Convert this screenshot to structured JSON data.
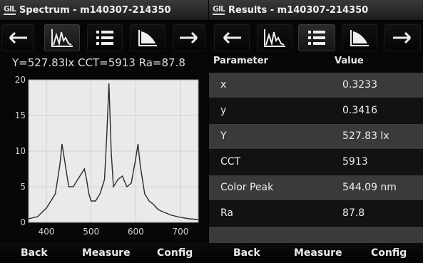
{
  "left": {
    "logo": "GIL",
    "title": "Spectrum - m140307-214350",
    "toolbar": [
      "back-arrow-icon",
      "spectrum-icon",
      "list-icon",
      "gamut-icon",
      "forward-arrow-icon"
    ],
    "readout": "Y=527.83lx   CCT=5913   Ra=87.8",
    "bottom": {
      "back": "Back",
      "measure": "Measure",
      "config": "Config"
    }
  },
  "right": {
    "logo": "GIL",
    "title": "Results - m140307-214350",
    "toolbar": [
      "back-arrow-icon",
      "spectrum-icon",
      "list-icon",
      "gamut-icon",
      "forward-arrow-icon"
    ],
    "headers": {
      "parameter": "Parameter",
      "value": "Value"
    },
    "rows": [
      {
        "param": "x",
        "value": "0.3233"
      },
      {
        "param": "y",
        "value": "0.3416"
      },
      {
        "param": "Y",
        "value": "527.83 lx"
      },
      {
        "param": "CCT",
        "value": "5913"
      },
      {
        "param": "Color Peak",
        "value": "544.09 nm"
      },
      {
        "param": "Ra",
        "value": "87.8"
      }
    ],
    "bottom": {
      "back": "Back",
      "measure": "Measure",
      "config": "Config"
    }
  },
  "chart_data": {
    "type": "line",
    "xlim": [
      360,
      740
    ],
    "ylim": [
      0,
      20
    ],
    "x_ticks": [
      400,
      500,
      600,
      700
    ],
    "y_ticks": [
      0,
      5,
      10,
      15,
      20
    ],
    "grid": true,
    "line_color": "#2a2a2a",
    "x": [
      360,
      380,
      400,
      420,
      430,
      435,
      440,
      450,
      460,
      470,
      480,
      485,
      490,
      495,
      500,
      510,
      520,
      530,
      535,
      540,
      545,
      550,
      560,
      570,
      580,
      590,
      600,
      605,
      610,
      620,
      630,
      640,
      650,
      660,
      680,
      700,
      720,
      740
    ],
    "y": [
      0.5,
      0.8,
      2,
      4,
      8,
      11,
      9,
      5,
      5,
      6,
      7,
      7.5,
      6,
      4,
      3,
      3,
      4,
      6,
      12,
      19.5,
      10,
      5,
      6,
      6.5,
      5,
      5.5,
      9,
      11,
      8,
      4,
      3,
      2.5,
      1.8,
      1.5,
      1,
      0.7,
      0.5,
      0.4
    ]
  }
}
